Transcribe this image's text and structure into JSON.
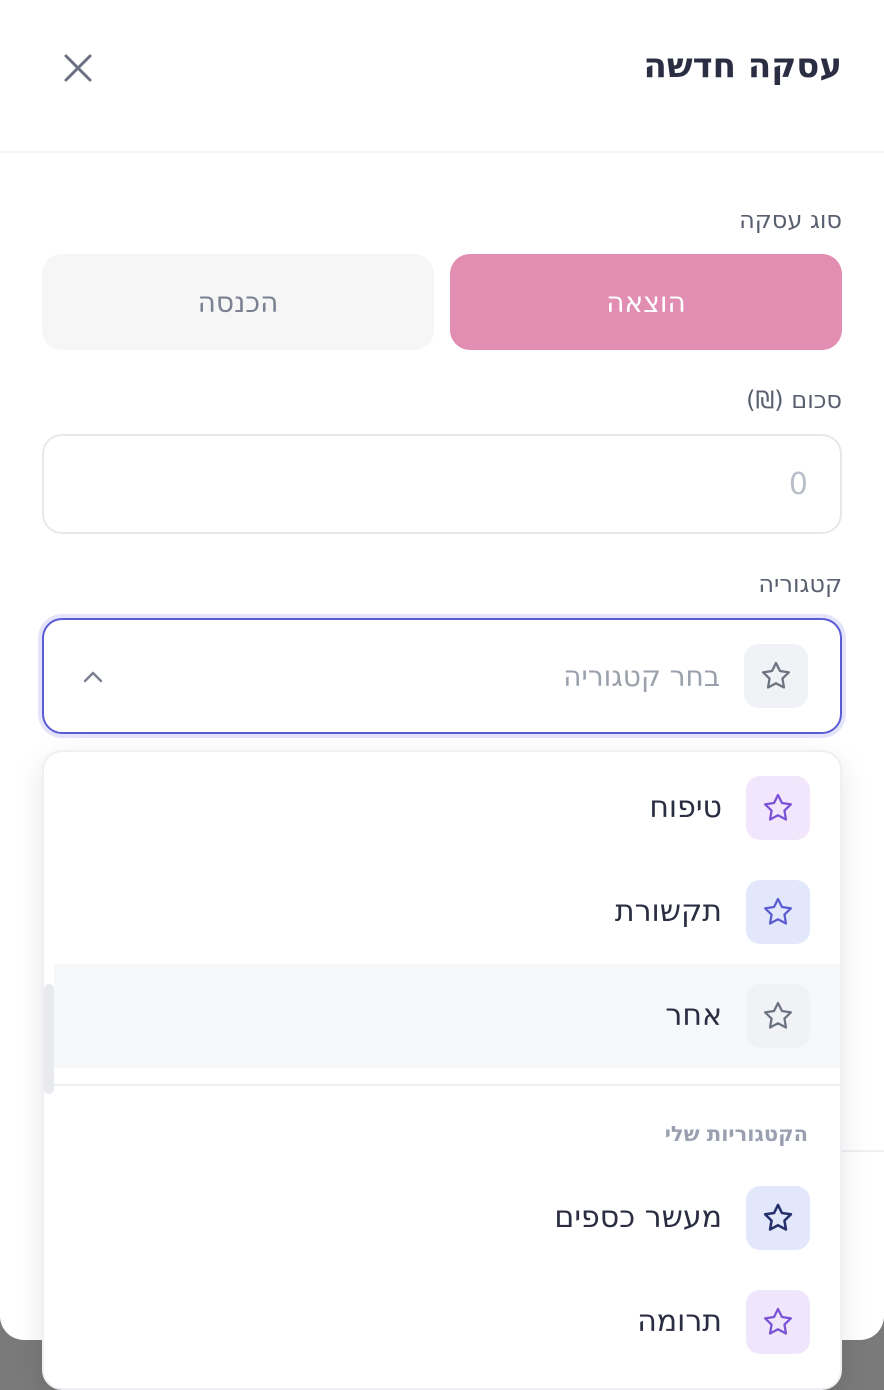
{
  "header": {
    "title": "עסקה חדשה"
  },
  "form": {
    "type_label": "סוג עסקה",
    "expense_label": "הוצאה",
    "income_label": "הכנסה",
    "amount_label": "סכום (₪)",
    "amount_placeholder": "0",
    "category_label": "קטגוריה",
    "category_placeholder": "בחר קטגוריה"
  },
  "dropdown": {
    "options": [
      {
        "label": "טיפוח",
        "icon": "star-icon",
        "icon_bg": "#f1e6fb",
        "icon_color": "#7a52d6"
      },
      {
        "label": "תקשורת",
        "icon": "star-icon",
        "icon_bg": "#e3e7fb",
        "icon_color": "#5a5cd0"
      },
      {
        "label": "אחר",
        "icon": "star-icon",
        "icon_bg": "#f0f2f6",
        "icon_color": "#6b7280"
      }
    ],
    "my_categories_label": "הקטגוריות שלי",
    "my_categories": [
      {
        "label": "מעשר כספים",
        "icon": "star-icon",
        "icon_bg": "#e3e7fb",
        "icon_color": "#26306a"
      },
      {
        "label": "תרומה",
        "icon": "star-icon",
        "icon_bg": "#efe6fb",
        "icon_color": "#7a52d6"
      }
    ]
  },
  "colors": {
    "accent": "#5b5bd6",
    "expense": "#e28db2",
    "title": "#2b2d42"
  }
}
